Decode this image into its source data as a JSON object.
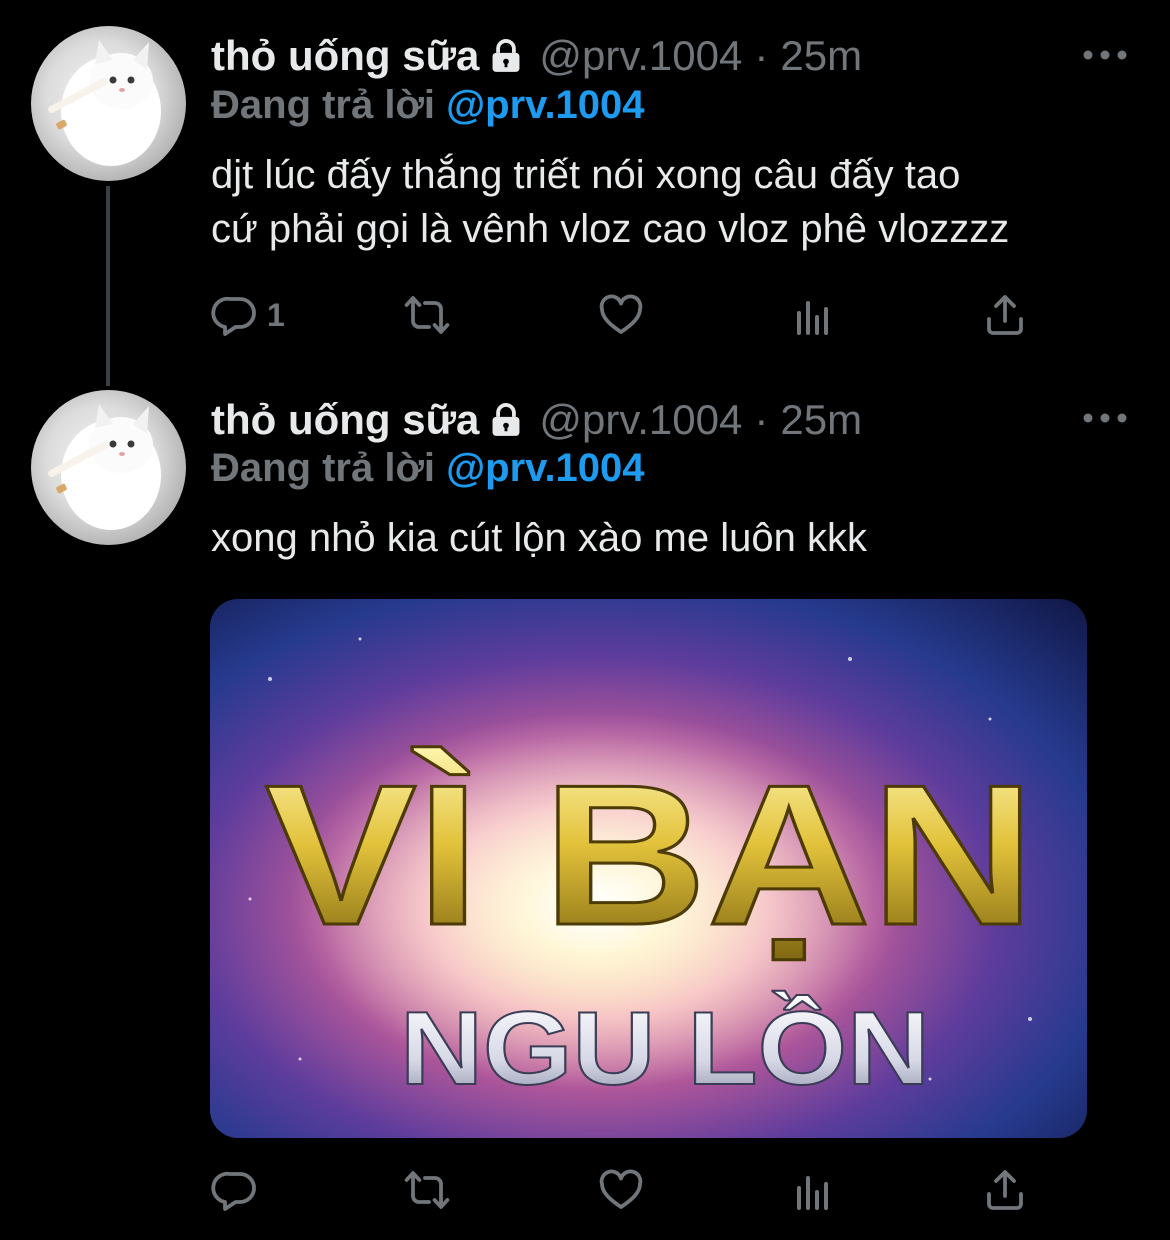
{
  "tweets": [
    {
      "display_name": "thỏ uống sữa",
      "handle": "@prv.1004",
      "separator": "·",
      "time": "25m",
      "reply_prefix": "Đang trả lời",
      "reply_handle": "@prv.1004",
      "text_line1": "djt lúc đấy thắng triết nói xong câu đấy tao",
      "text_line2": "cứ phải gọi là vênh vloz cao vloz phê vlozzzz",
      "reply_count": "1"
    },
    {
      "display_name": "thỏ uống sữa",
      "handle": "@prv.1004",
      "separator": "·",
      "time": "25m",
      "reply_prefix": "Đang trả lời",
      "reply_handle": "@prv.1004",
      "text_line1": "xong nhỏ kia cút lộn xào me luôn kkk",
      "media_text_line1": "VÌ BẠN",
      "media_text_line2": "NGU LỒN",
      "reply_count": ""
    }
  ],
  "colors": {
    "background": "#000000",
    "primary_text": "#e7e9ea",
    "secondary_text": "#71767b",
    "link": "#1d9bf0",
    "thread_line": "#3a3f44"
  },
  "icons": [
    "lock-icon",
    "more-icon",
    "reply-icon",
    "retweet-icon",
    "like-icon",
    "analytics-icon",
    "share-icon"
  ]
}
